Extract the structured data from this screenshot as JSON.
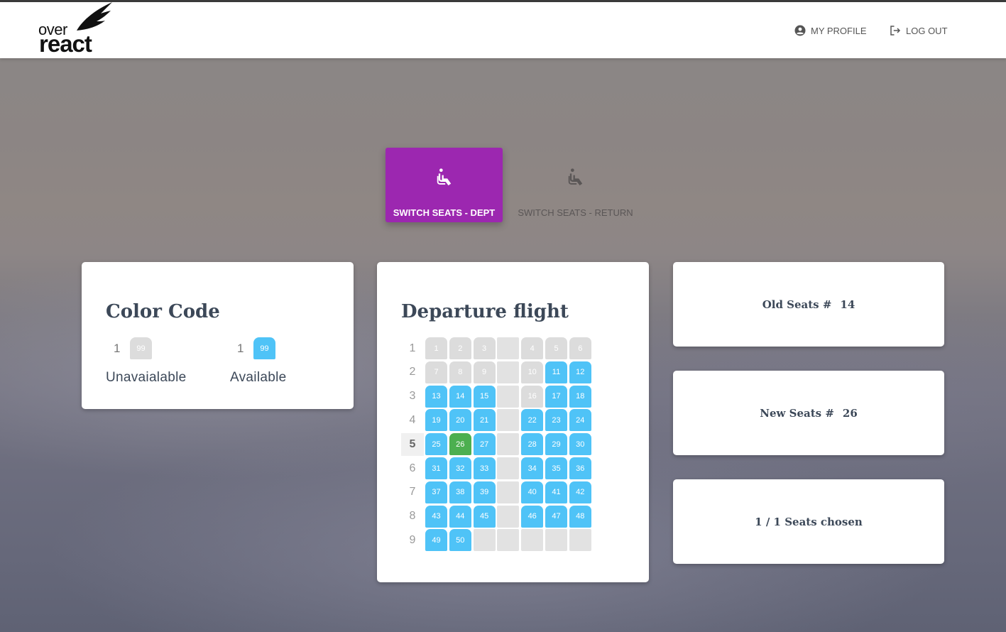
{
  "header": {
    "logo_over": "over",
    "logo_react": "react",
    "profile_label": "MY PROFILE",
    "logout_label": "LOG OUT"
  },
  "tabs": [
    {
      "label": "SWITCH SEATS - DEPT",
      "active": true
    },
    {
      "label": "SWITCH SEATS - RETURN",
      "active": false
    }
  ],
  "color_code": {
    "title": "Color Code",
    "items": [
      {
        "row": "1",
        "seat": "99",
        "status": "unavailable",
        "label": "Unavaialable"
      },
      {
        "row": "1",
        "seat": "99",
        "status": "available",
        "label": "Available"
      }
    ]
  },
  "flight": {
    "title": "Departure flight",
    "selected_row": "5",
    "rows": [
      {
        "label": "1",
        "seats": [
          [
            "1",
            "unavailable"
          ],
          [
            "2",
            "unavailable"
          ],
          [
            "3",
            "unavailable"
          ],
          [
            "",
            "empty"
          ],
          [
            "4",
            "unavailable"
          ],
          [
            "5",
            "unavailable"
          ],
          [
            "6",
            "unavailable"
          ]
        ]
      },
      {
        "label": "2",
        "seats": [
          [
            "7",
            "unavailable"
          ],
          [
            "8",
            "unavailable"
          ],
          [
            "9",
            "unavailable"
          ],
          [
            "",
            "empty"
          ],
          [
            "10",
            "unavailable"
          ],
          [
            "11",
            "available"
          ],
          [
            "12",
            "available"
          ]
        ]
      },
      {
        "label": "3",
        "seats": [
          [
            "13",
            "available"
          ],
          [
            "14",
            "available"
          ],
          [
            "15",
            "available"
          ],
          [
            "",
            "empty"
          ],
          [
            "16",
            "unavailable"
          ],
          [
            "17",
            "available"
          ],
          [
            "18",
            "available"
          ]
        ]
      },
      {
        "label": "4",
        "seats": [
          [
            "19",
            "available"
          ],
          [
            "20",
            "available"
          ],
          [
            "21",
            "available"
          ],
          [
            "",
            "empty"
          ],
          [
            "22",
            "available"
          ],
          [
            "23",
            "available"
          ],
          [
            "24",
            "available"
          ]
        ]
      },
      {
        "label": "5",
        "seats": [
          [
            "25",
            "available"
          ],
          [
            "26",
            "selected"
          ],
          [
            "27",
            "available"
          ],
          [
            "",
            "empty"
          ],
          [
            "28",
            "available"
          ],
          [
            "29",
            "available"
          ],
          [
            "30",
            "available"
          ]
        ]
      },
      {
        "label": "6",
        "seats": [
          [
            "31",
            "available"
          ],
          [
            "32",
            "available"
          ],
          [
            "33",
            "available"
          ],
          [
            "",
            "empty"
          ],
          [
            "34",
            "available"
          ],
          [
            "35",
            "available"
          ],
          [
            "36",
            "available"
          ]
        ]
      },
      {
        "label": "7",
        "seats": [
          [
            "37",
            "available"
          ],
          [
            "38",
            "available"
          ],
          [
            "39",
            "available"
          ],
          [
            "",
            "empty"
          ],
          [
            "40",
            "available"
          ],
          [
            "41",
            "available"
          ],
          [
            "42",
            "available"
          ]
        ]
      },
      {
        "label": "8",
        "seats": [
          [
            "43",
            "available"
          ],
          [
            "44",
            "available"
          ],
          [
            "45",
            "available"
          ],
          [
            "",
            "empty"
          ],
          [
            "46",
            "available"
          ],
          [
            "47",
            "available"
          ],
          [
            "48",
            "available"
          ]
        ]
      },
      {
        "label": "9",
        "seats": [
          [
            "49",
            "available"
          ],
          [
            "50",
            "available"
          ],
          [
            "",
            "empty"
          ],
          [
            "",
            "empty"
          ],
          [
            "",
            "empty"
          ],
          [
            "",
            "empty"
          ],
          [
            "",
            "empty"
          ]
        ]
      }
    ]
  },
  "summary": {
    "old_label": "Old Seats #",
    "old_value": "14",
    "new_label": "New Seats #",
    "new_value": "26",
    "chosen": "1 / 1 Seats chosen"
  },
  "colors": {
    "accent": "#9c27b0",
    "available": "#4fc3f7",
    "unavailable": "#dcdcdc",
    "selected": "#4caf50",
    "text_dark": "#3c4858"
  }
}
